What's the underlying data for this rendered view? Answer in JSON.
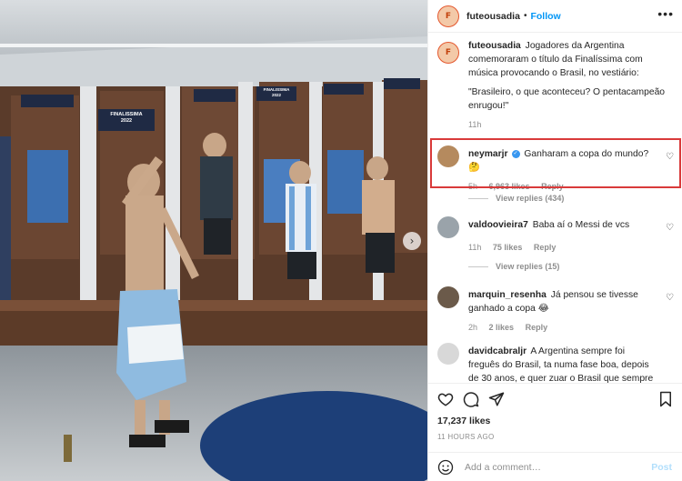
{
  "colors": {
    "accent": "#0095f6",
    "highlight": "#d93a3a",
    "verified": "#3897f0",
    "muted": "#8e8e8e"
  },
  "media": {
    "banner_1": "FINALISSIMA",
    "banner_1_year": "2022",
    "banner_2": "FINALISSIMA",
    "banner_2_year": "2022",
    "next_icon": "chevron-right-icon"
  },
  "header": {
    "username": "futeousadia",
    "separator": "•",
    "follow": "Follow",
    "more_icon": "more-horizontal-icon"
  },
  "caption": {
    "username": "futeousadia",
    "text": "Jogadores da Argentina comemoraram o título da Finalíssima com música provocando o Brasil, no vestiário:",
    "quote": "\"Brasileiro, o que aconteceu? O pentacampeão enrugou!\"",
    "time": "11h"
  },
  "comments": [
    {
      "username": "neymarjr",
      "verified": true,
      "text": "Ganharam a copa do mundo? 🤔",
      "time": "5h",
      "likes": "6,963 likes",
      "reply": "Reply",
      "view_replies": "View replies (434)"
    },
    {
      "username": "valdoovieira7",
      "verified": false,
      "text": "Baba aí o Messi de vcs",
      "time": "11h",
      "likes": "75 likes",
      "reply": "Reply",
      "view_replies": "View replies (15)"
    },
    {
      "username": "marquin_resenha",
      "verified": false,
      "text": "Já pensou se tivesse ganhado a copa 😂",
      "time": "2h",
      "likes": "2 likes",
      "reply": "Reply"
    },
    {
      "username": "davidcabraljr",
      "verified": false,
      "text": "A Argentina sempre foi freguês do Brasil, ta numa fase boa, depois de 30 anos, e quer zuar o Brasil que sempre esteve no topo"
    }
  ],
  "actions": {
    "like_icon": "heart-icon",
    "comment_icon": "comment-icon",
    "share_icon": "send-icon",
    "save_icon": "bookmark-icon"
  },
  "likes_count": "17,237 likes",
  "time_ago": "11 HOURS AGO",
  "add_comment": {
    "emoji_icon": "emoji-icon",
    "placeholder": "Add a comment…",
    "post": "Post"
  }
}
